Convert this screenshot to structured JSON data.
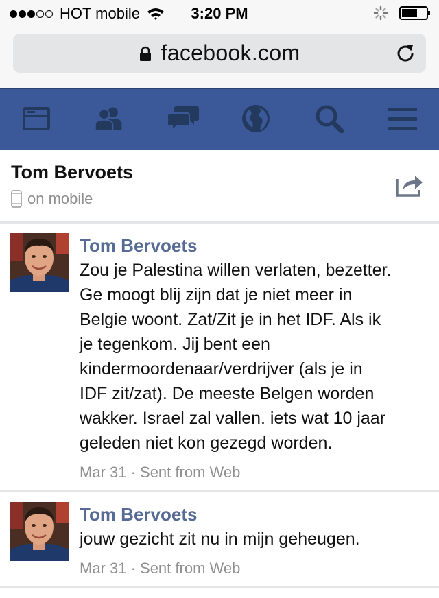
{
  "status_bar": {
    "carrier": "HOT mobile",
    "time": "3:20 PM",
    "signal_bars_filled": 3,
    "signal_bars_total": 5
  },
  "browser": {
    "url": "facebook.com"
  },
  "nav": {
    "icons": [
      "news-feed-icon",
      "friends-icon",
      "messages-icon",
      "notifications-globe-icon",
      "search-icon",
      "menu-icon"
    ],
    "background": "#3b5998"
  },
  "conversation": {
    "name": "Tom Bervoets",
    "status": "on mobile"
  },
  "messages": [
    {
      "author": "Tom Bervoets",
      "lines": [
        "Zou je Palestina willen verlaten, bezetter.",
        "Ge moogt blij zijn dat je niet meer in",
        "Belgie woont. Zat/Zit je in het IDF. Als ik",
        "je tegenkom. Jij bent een",
        "kindermoordenaar/verdrijver (als je in",
        "IDF zit/zat). De meeste Belgen worden",
        "wakker. Israel zal vallen. iets wat 10 jaar",
        "geleden niet kon gezegd worden."
      ],
      "meta": "Mar 31 · Sent from Web"
    },
    {
      "author": "Tom Bervoets",
      "lines": [
        "jouw gezicht zit nu in mijn geheugen."
      ],
      "meta": "Mar 31 · Sent from Web"
    }
  ],
  "colors": {
    "author": "#576b95",
    "meta": "#8f8f8f"
  }
}
